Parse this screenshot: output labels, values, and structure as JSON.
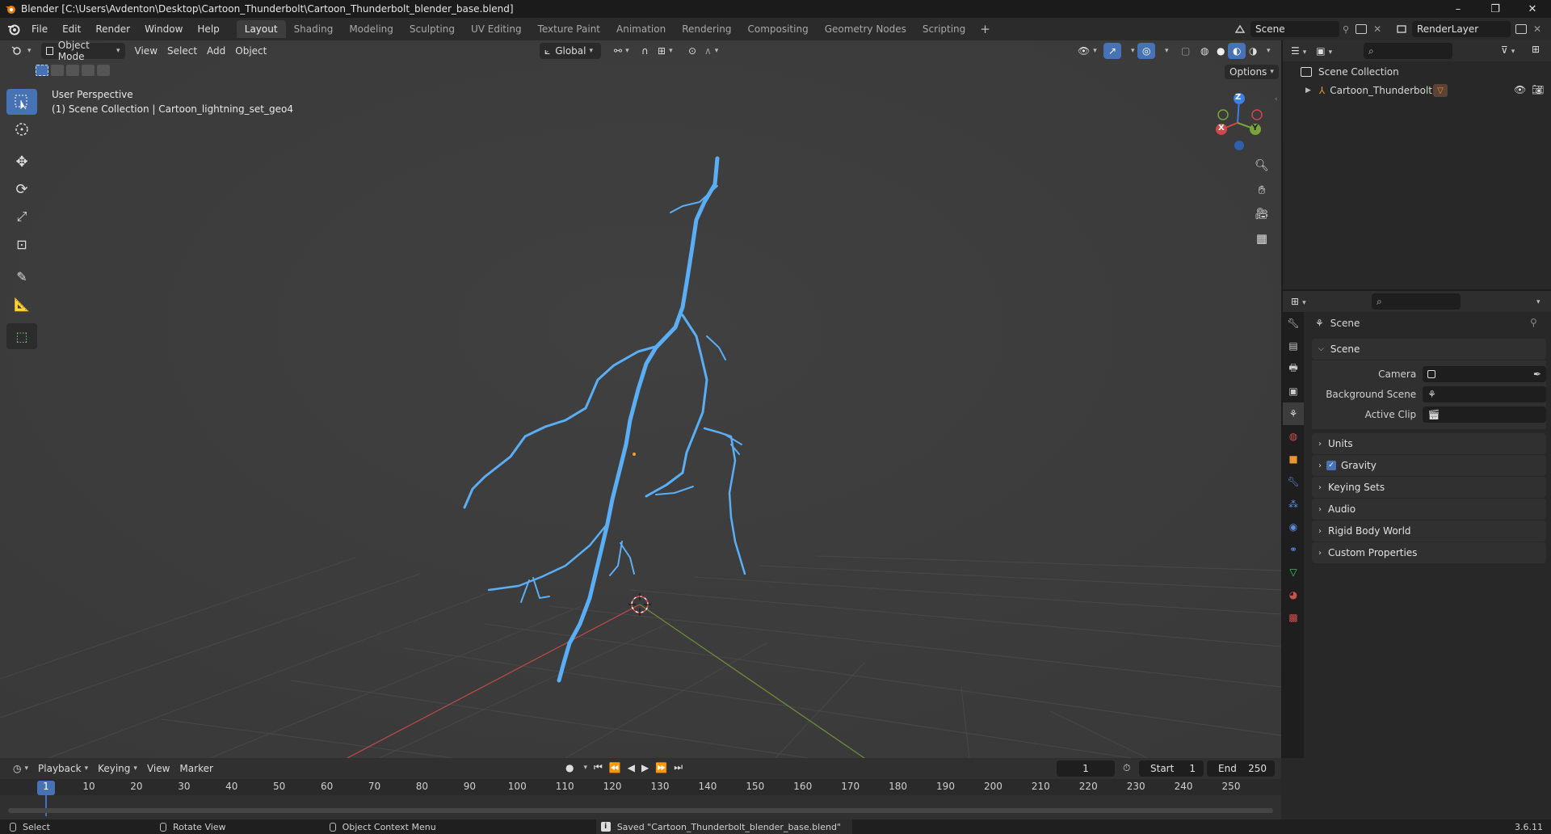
{
  "window": {
    "title": "Blender [C:\\Users\\Avdenton\\Desktop\\Cartoon_Thunderbolt\\Cartoon_Thunderbolt_blender_base.blend]",
    "minimize": "–",
    "maximize": "❐",
    "close": "✕"
  },
  "menus": [
    "File",
    "Edit",
    "Render",
    "Window",
    "Help"
  ],
  "workspaces": [
    "Layout",
    "Shading",
    "Modeling",
    "Sculpting",
    "UV Editing",
    "Texture Paint",
    "Animation",
    "Rendering",
    "Compositing",
    "Geometry Nodes",
    "Scripting"
  ],
  "active_workspace": "Layout",
  "add_workspace": "+",
  "scene_selector": "Scene",
  "view_layer": "RenderLayer",
  "viewport": {
    "mode": "Object Mode",
    "menus": [
      "View",
      "Select",
      "Add",
      "Object"
    ],
    "orientation": "Global",
    "options": "Options",
    "info_line1": "User Perspective",
    "info_line2": "(1) Scene Collection | Cartoon_lightning_set_geo4",
    "gizmo": {
      "z": "Z",
      "x": "X",
      "y": "Y"
    }
  },
  "outliner": {
    "root": "Scene Collection",
    "items": [
      {
        "name": "Cartoon_Thunderbolt"
      }
    ]
  },
  "properties": {
    "context": "Scene",
    "scene_section": "Scene",
    "rows": [
      {
        "label": "Camera",
        "value": ""
      },
      {
        "label": "Background Scene",
        "value": ""
      },
      {
        "label": "Active Clip",
        "value": ""
      }
    ],
    "collapsed_sections": [
      "Units",
      "Gravity",
      "Keying Sets",
      "Audio",
      "Rigid Body World",
      "Custom Properties"
    ],
    "gravity_checked": true
  },
  "timeline": {
    "menus": [
      "Playback",
      "Keying",
      "View",
      "Marker"
    ],
    "current_frame": "1",
    "start_label": "Start",
    "start": "1",
    "end_label": "End",
    "end": "250",
    "ruler": [
      "1",
      "10",
      "20",
      "30",
      "40",
      "50",
      "60",
      "70",
      "80",
      "90",
      "100",
      "110",
      "120",
      "130",
      "140",
      "150",
      "160",
      "170",
      "180",
      "190",
      "200",
      "210",
      "220",
      "230",
      "240",
      "250"
    ]
  },
  "status": {
    "select": "Select",
    "rotate": "Rotate View",
    "context_menu": "Object Context Menu",
    "message": "Saved \"Cartoon_Thunderbolt_blender_base.blend\"",
    "version": "3.6.11"
  },
  "colors": {
    "accent": "#4772b3",
    "lightning": "#5aaef5",
    "x_axis": "#d04848",
    "y_axis": "#7aa33b",
    "z_axis": "#3c7fe6"
  }
}
